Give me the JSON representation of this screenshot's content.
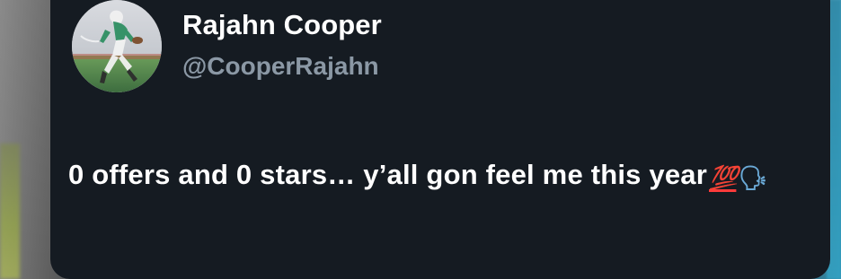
{
  "tweet": {
    "author": {
      "name": "Rajahn Cooper",
      "handle": "@CooperRajahn",
      "avatar_icon": "football-player-avatar"
    },
    "text": "0 offers and 0 stars… y’all gon feel me this year",
    "emoji": {
      "hundred": "💯",
      "speaking_head": "🗣"
    }
  },
  "colors": {
    "card_bg": "#151b22",
    "name": "#ffffff",
    "handle": "#8b98a5"
  }
}
